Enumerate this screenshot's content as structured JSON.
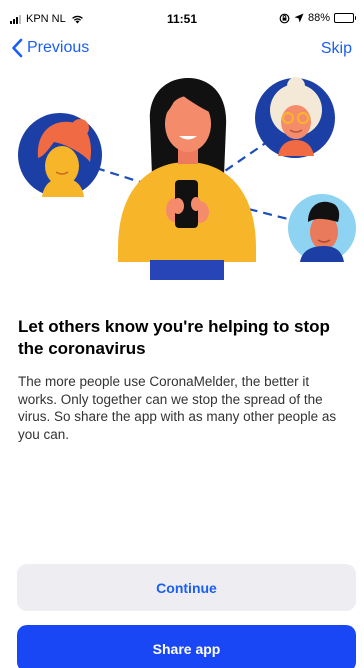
{
  "status_bar": {
    "carrier": "KPN NL",
    "time": "11:51",
    "battery": "88%",
    "battery_level": 0.88
  },
  "nav": {
    "back_label": "Previous",
    "skip_label": "Skip",
    "accent_color": "#1a5ff3"
  },
  "content": {
    "title": "Let others know you're helping to stop the coronavirus",
    "body": "The more people use CoronaMelder, the better it works. Only together can we stop the spread of the virus. So share the app with as many other people as you can."
  },
  "buttons": {
    "continue_label": "Continue",
    "share_label": "Share app",
    "primary_color": "#1a47f5"
  }
}
